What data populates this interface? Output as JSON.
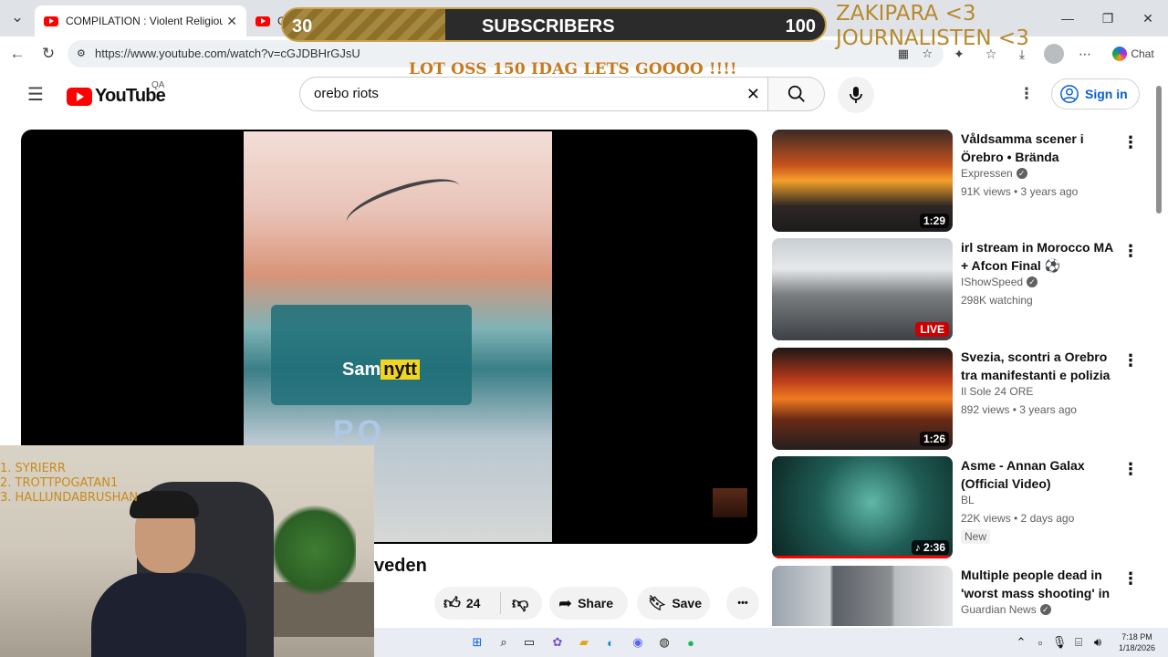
{
  "browser": {
    "tabs": [
      {
        "label": "COMPILATION : Violent Religious I",
        "close": "✕"
      },
      {
        "label": "G",
        "close": "✕"
      }
    ],
    "new_tab": "+",
    "url": "https://www.youtube.com/watch?v=cGJDBHrGJsU",
    "chat_label": "Chat",
    "window_controls": {
      "minimize": "—",
      "maximize": "❐",
      "close": "✕"
    }
  },
  "overlay": {
    "sub_goal": {
      "current": "30",
      "label": "SUBSCRIBERS",
      "target": "100",
      "progress": 0.3
    },
    "shoutout_lines": [
      "ZAKIPARA <3",
      "JOURNALISTEN <3"
    ],
    "banner": "LOT OSS 150 IDAG LETS GOOOO !!!!",
    "top_list": [
      "1.  SYRIERR",
      "2.  TROTTPOGATAN1",
      "3.  HALLUNDABRUSHAN"
    ]
  },
  "youtube": {
    "logo_text": "YouTube",
    "country": "QA",
    "search_query": "orebo riots",
    "sign_in": "Sign in",
    "player": {
      "watermark_left": "Sam",
      "watermark_right": "nytt",
      "van_text": "PO"
    },
    "video_title_visible": "veden",
    "actions": {
      "likes": "24",
      "share": "Share",
      "save": "Save",
      "more": "•••"
    }
  },
  "recommendations": [
    {
      "title": "Våldsamma scener i Örebro • Brända polisbilar • ...",
      "channel": "Expressen",
      "verified": true,
      "meta": "91K views • 3 years ago",
      "duration": "1:29",
      "thumb": "fire-crowd"
    },
    {
      "title": "irl stream in Morocco MA + Afcon Final ⚽",
      "channel": "IShowSpeed",
      "verified": true,
      "meta": "298K watching",
      "duration": "LIVE",
      "thumb": "street"
    },
    {
      "title": "Svezia, scontri a Orebro tra manifestanti e polizia",
      "channel": "Il Sole 24 ORE",
      "verified": false,
      "meta": "892 views • 3 years ago",
      "duration": "1:26",
      "thumb": "burning-van"
    },
    {
      "title": "Asme - Annan Galax (Official Video)",
      "channel": "BL",
      "verified": false,
      "meta": "22K views • 2 days ago",
      "duration": "♪ 2:36",
      "thumb": "green",
      "badge": "New"
    },
    {
      "title": "Multiple people dead in 'worst mass shooting' in ...",
      "channel": "Guardian News",
      "verified": true,
      "meta": "",
      "duration": "",
      "thumb": "collage"
    }
  ],
  "taskbar": {
    "time": "7:18 PM",
    "date": "1/18/2026"
  },
  "colors": {
    "youtube_red": "#ff0000",
    "link_blue": "#065fd4",
    "overlay_gold": "#c9a24a",
    "overlay_orange": "#c77a1d"
  }
}
